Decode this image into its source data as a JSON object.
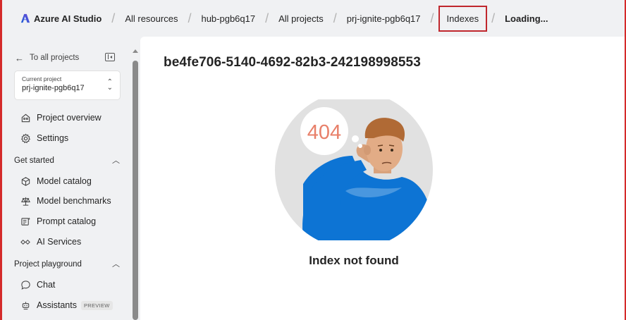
{
  "header": {
    "app_title": "Azure AI Studio",
    "breadcrumbs": [
      "All resources",
      "hub-pgb6q17",
      "All projects",
      "prj-ignite-pgb6q17",
      "Indexes",
      "Loading..."
    ]
  },
  "sidebar": {
    "back_label": "To all projects",
    "project_card": {
      "label": "Current project",
      "value": "prj-ignite-pgb6q17"
    },
    "items_top": [
      {
        "label": "Project overview",
        "icon": "home-icon"
      },
      {
        "label": "Settings",
        "icon": "gear-icon"
      }
    ],
    "sections": [
      {
        "title": "Get started",
        "items": [
          {
            "label": "Model catalog",
            "icon": "cube-icon"
          },
          {
            "label": "Model benchmarks",
            "icon": "scale-icon"
          },
          {
            "label": "Prompt catalog",
            "icon": "prompt-icon"
          },
          {
            "label": "AI Services",
            "icon": "link-icon"
          }
        ]
      },
      {
        "title": "Project playground",
        "items": [
          {
            "label": "Chat",
            "icon": "chat-icon"
          },
          {
            "label": "Assistants",
            "icon": "bot-icon",
            "badge": "PREVIEW"
          }
        ]
      }
    ]
  },
  "main": {
    "title": "be4fe706-5140-4692-82b3-242198998553",
    "error_code": "404",
    "message": "Index not found"
  },
  "colors": {
    "accent_blue": "#0078d4",
    "highlight_red": "#c0272d",
    "error_code": "#e8806a"
  }
}
